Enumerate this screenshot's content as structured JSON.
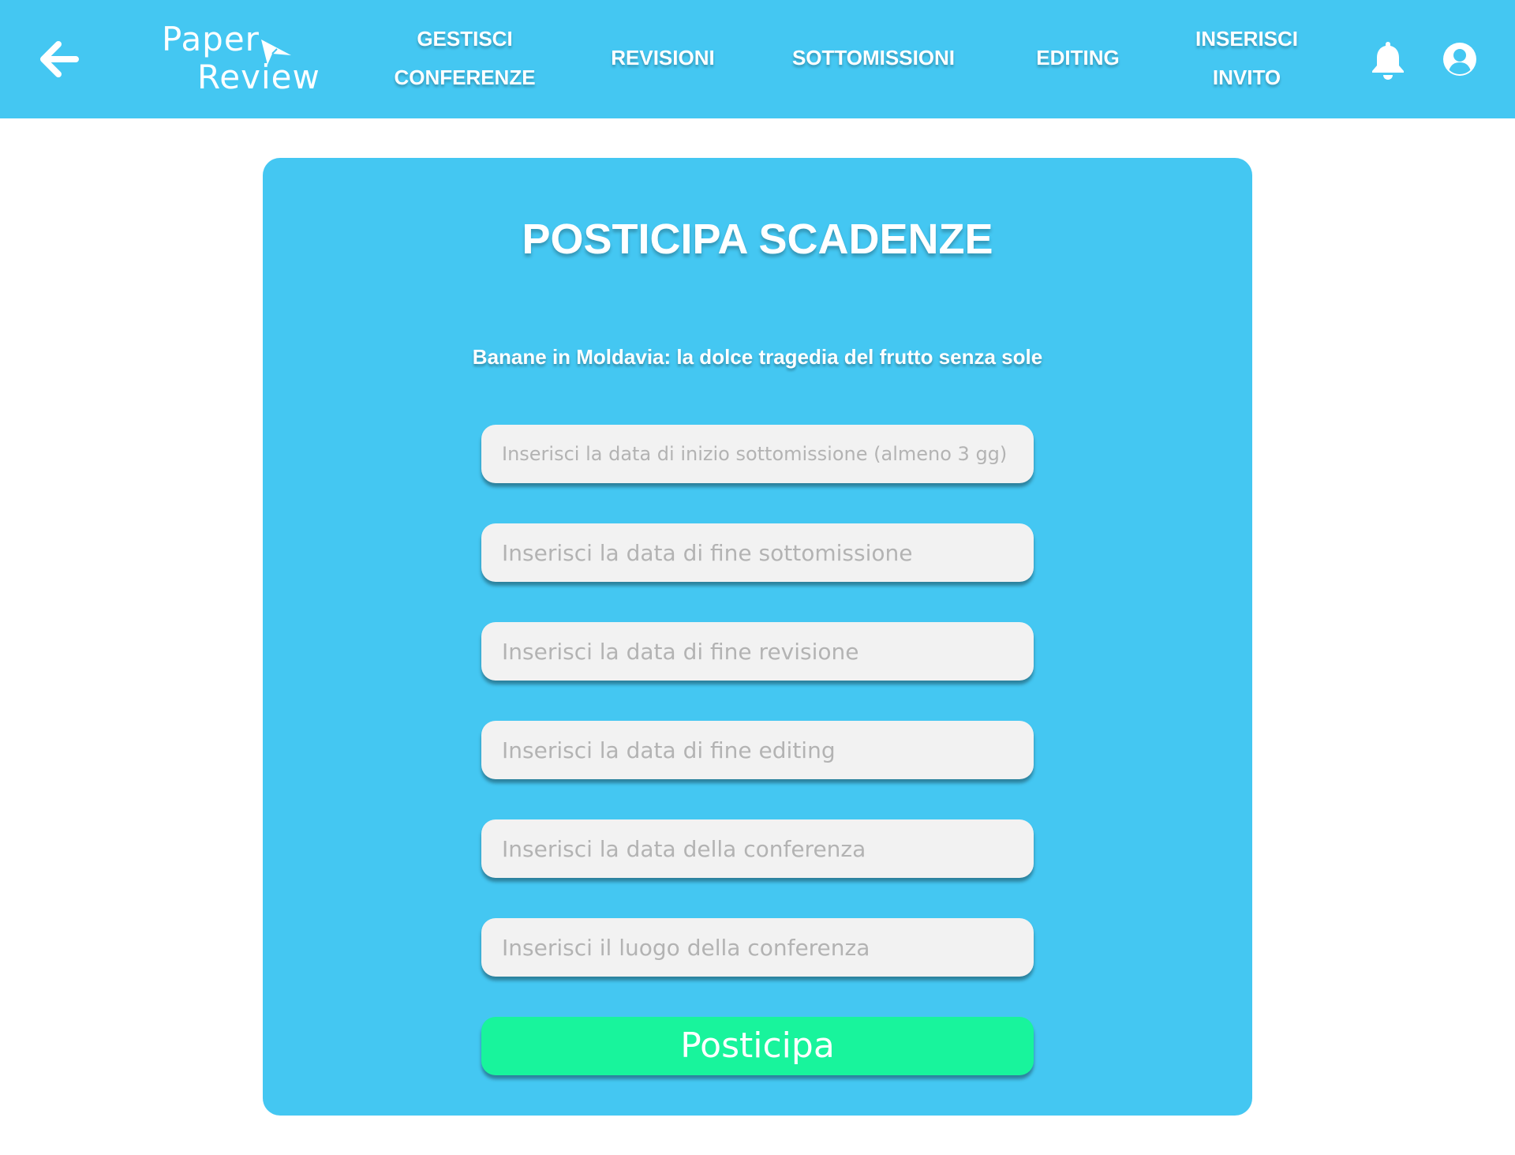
{
  "navbar": {
    "background": "#44c7f2",
    "back_icon": "arrow-left-icon",
    "logo": {
      "line1": "Paper",
      "line2": "Review",
      "icon": "paper-plane-icon"
    },
    "items": [
      {
        "line1": "GESTISCI",
        "line2": "CONFERENZE"
      },
      {
        "line1": "REVISIONI"
      },
      {
        "line1": "SOTTOMISSIONI"
      },
      {
        "line1": "EDITING"
      },
      {
        "line1": "INSERISCI",
        "line2": "INVITO"
      }
    ],
    "notification_icon": "bell-icon",
    "profile_icon": "user-circle-icon"
  },
  "card": {
    "background": "#44c7f2",
    "title": "POSTICIPA SCADENZE",
    "subtitle": "Banane in Moldavia: la dolce tragedia del frutto senza sole"
  },
  "form": {
    "fields": [
      {
        "value": "",
        "placeholder": "Inserisci la data di inizio sottomissione (almeno 3 gg)"
      },
      {
        "value": "",
        "placeholder": "Inserisci la data di fine sottomissione"
      },
      {
        "value": "",
        "placeholder": "Inserisci la data di fine revisione"
      },
      {
        "value": "",
        "placeholder": "Inserisci la data di fine editing"
      },
      {
        "value": "",
        "placeholder": "Inserisci la data della conferenza"
      },
      {
        "value": "",
        "placeholder": "Inserisci il luogo della conferenza"
      }
    ],
    "submit_label": "Posticipa",
    "submit_color": "#18f49c"
  }
}
